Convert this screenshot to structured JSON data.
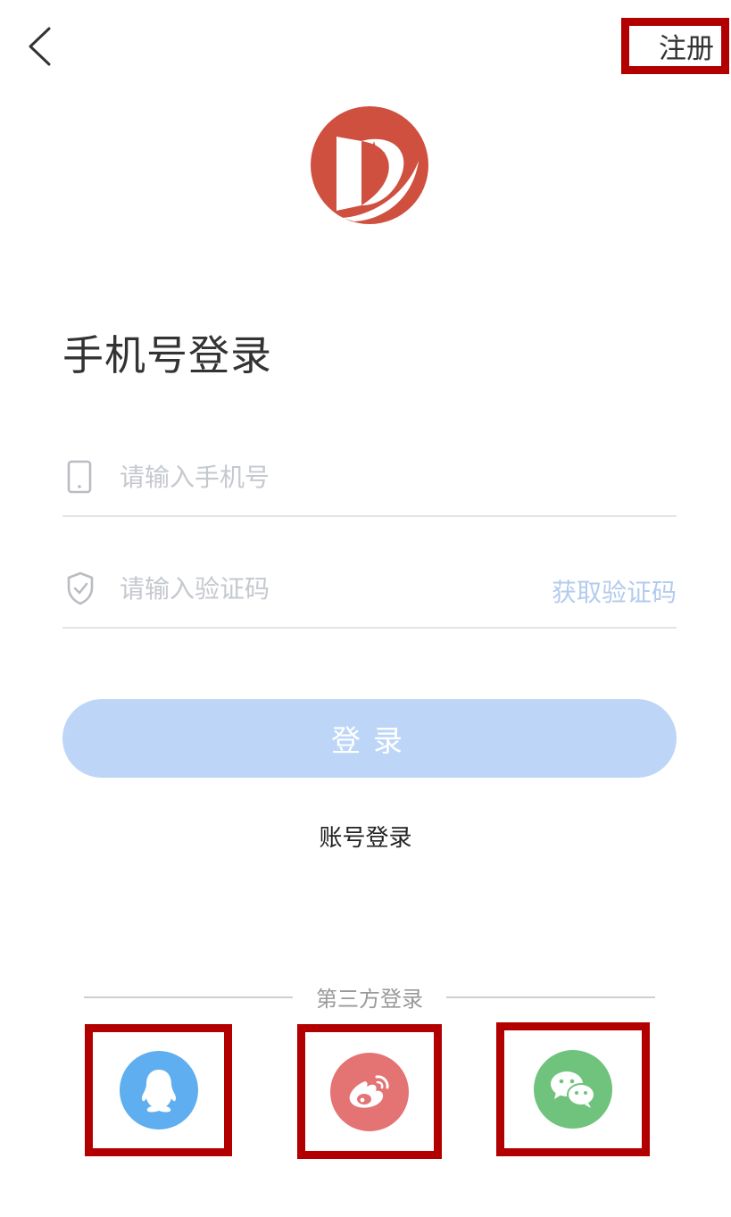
{
  "header": {
    "register_label": "注册"
  },
  "title": "手机号登录",
  "form": {
    "phone_placeholder": "请输入手机号",
    "code_placeholder": "请输入验证码",
    "get_code_label": "获取验证码",
    "login_label": "登录"
  },
  "account_login_label": "账号登录",
  "third_party": {
    "label": "第三方登录",
    "providers": [
      {
        "name": "QQ",
        "icon": "qq-icon",
        "color": "#5eaef0"
      },
      {
        "name": "Weibo",
        "icon": "weibo-icon",
        "color": "#e47373"
      },
      {
        "name": "WeChat",
        "icon": "wechat-icon",
        "color": "#6fc37c"
      }
    ]
  },
  "colors": {
    "brand": "#d0503f",
    "login_button": "#bdd6f7",
    "link": "#b3cbed",
    "highlight_frame": "#b20000"
  }
}
